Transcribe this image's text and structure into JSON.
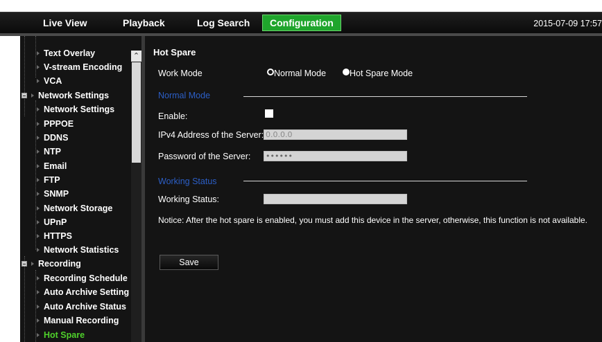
{
  "top_nav": {
    "tabs": [
      {
        "label": "Live View"
      },
      {
        "label": "Playback"
      },
      {
        "label": "Log Search"
      },
      {
        "label": "Configuration",
        "active": true
      }
    ],
    "datetime": "2015-07-09 17:57"
  },
  "sidebar": {
    "items": [
      {
        "label": "Text Overlay"
      },
      {
        "label": "V-stream Encoding"
      },
      {
        "label": "VCA"
      },
      {
        "label": "Network Settings",
        "category": true
      },
      {
        "label": "Network Settings"
      },
      {
        "label": "PPPOE"
      },
      {
        "label": "DDNS"
      },
      {
        "label": "NTP"
      },
      {
        "label": "Email"
      },
      {
        "label": "FTP"
      },
      {
        "label": "SNMP"
      },
      {
        "label": "Network Storage"
      },
      {
        "label": "UPnP"
      },
      {
        "label": "HTTPS"
      },
      {
        "label": "Network Statistics"
      },
      {
        "label": "Recording",
        "category": true
      },
      {
        "label": "Recording Schedule"
      },
      {
        "label": "Auto Archive Setting"
      },
      {
        "label": "Auto Archive Status"
      },
      {
        "label": "Manual Recording"
      },
      {
        "label": "Hot Spare",
        "active": true
      }
    ]
  },
  "page": {
    "title": "Hot Spare",
    "work_mode_label": "Work Mode",
    "work_mode_options": [
      {
        "label": "Normal Mode",
        "selected": true
      },
      {
        "label": "Hot Spare Mode",
        "selected": false
      }
    ],
    "normal_mode_section": "Normal Mode",
    "enable_label": "Enable:",
    "enable_checked": false,
    "ipv4_label": "IPv4 Address of the Server:",
    "ipv4_value": "0.0.0.0",
    "password_label": "Password of the Server:",
    "password_value": "••••••",
    "working_status_section": "Working Status",
    "working_status_label": "Working Status:",
    "working_status_value": "",
    "notice": "Notice: After the hot spare is enabled, you must add this device in the server, otherwise, this function is not available.",
    "save_label": "Save"
  },
  "colors": {
    "accent_green": "#1fa52c",
    "section_blue": "#2c5fc7",
    "active_item": "#4fd12b",
    "background": "#141414"
  }
}
